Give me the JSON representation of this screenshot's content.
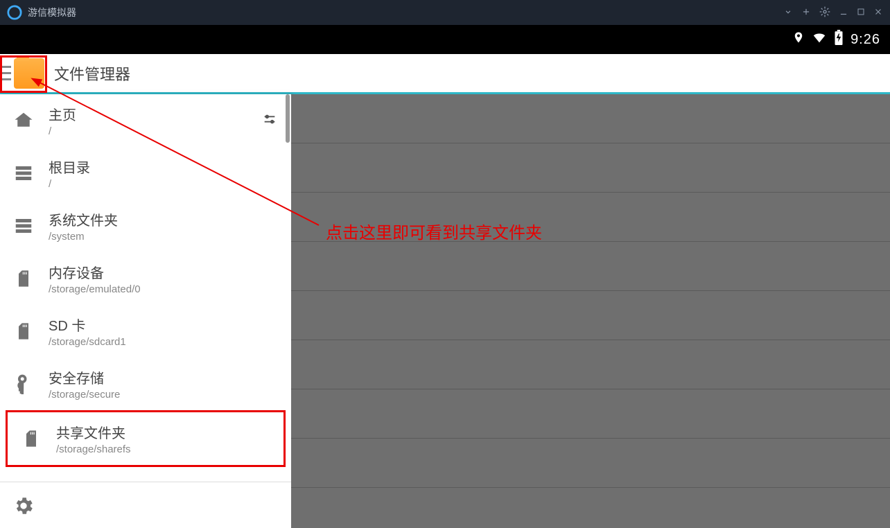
{
  "emulator": {
    "title": "游信模拟器"
  },
  "statusbar": {
    "time": "9:26"
  },
  "app": {
    "title": "文件管理器"
  },
  "annotation": {
    "text": "点击这里即可看到共享文件夹"
  },
  "drawer": {
    "items": [
      {
        "label": "主页",
        "path": "/"
      },
      {
        "label": "根目录",
        "path": "/"
      },
      {
        "label": "系统文件夹",
        "path": "/system"
      },
      {
        "label": "内存设备",
        "path": "/storage/emulated/0"
      },
      {
        "label": "SD 卡",
        "path": "/storage/sdcard1"
      },
      {
        "label": "安全存储",
        "path": "/storage/secure"
      },
      {
        "label": "共享文件夹",
        "path": "/storage/sharefs"
      }
    ]
  }
}
